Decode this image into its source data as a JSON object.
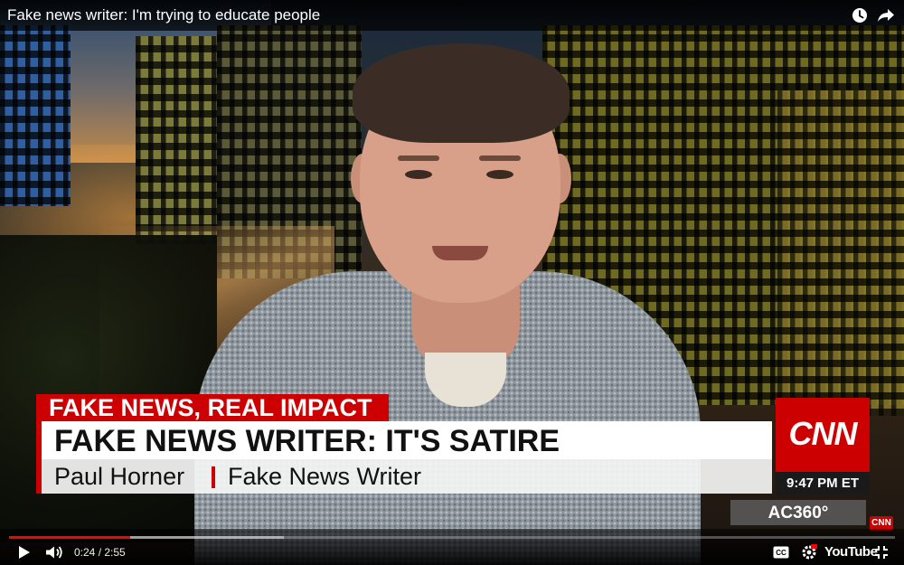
{
  "window": {
    "title": "Fake news writer: I'm trying to educate people"
  },
  "top_icons": [
    "clock-icon",
    "share-icon"
  ],
  "chyron": {
    "kicker": "FAKE NEWS, REAL IMPACT",
    "headline": "FAKE NEWS WRITER: IT'S SATIRE",
    "name": "Paul Horner",
    "role": "Fake News Writer"
  },
  "network": {
    "logo": "CNN",
    "time": "9:47 PM ET",
    "show": "AC360°",
    "corner_logo": "CNN",
    "brand_color": "#cc0000"
  },
  "player": {
    "current_time": "0:24",
    "duration": "2:55",
    "time_text": "0:24 / 2:55",
    "played_fraction": 0.137,
    "buffered_fraction": 0.31,
    "youtube_label": "YouTube",
    "accent_color": "#ff0000",
    "icons": [
      "play-icon",
      "volume-icon",
      "cc-icon",
      "settings-icon",
      "fullscreen-icon"
    ]
  }
}
